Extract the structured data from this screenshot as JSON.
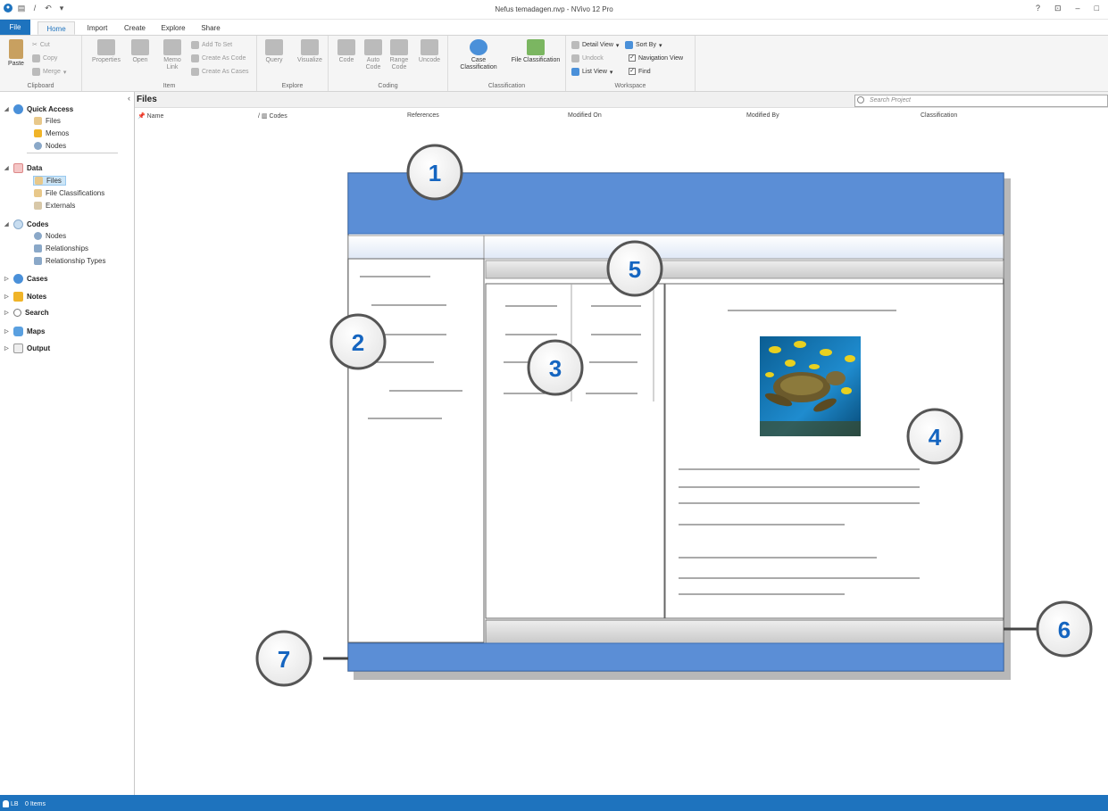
{
  "window": {
    "title": "Nefus temadagen.nvp - NVivo 12 Pro",
    "help": "?",
    "restore": "⊡",
    "minimize": "–",
    "maximize": "□"
  },
  "ribbon_tabs": [
    "File",
    "Home",
    "Import",
    "Create",
    "Explore",
    "Share"
  ],
  "ribbon": {
    "clipboard": {
      "paste": "Paste",
      "cut": "Cut",
      "copy": "Copy",
      "merge": "Merge",
      "label": "Clipboard"
    },
    "item": {
      "properties": "Properties",
      "open": "Open",
      "memo_link": "Memo Link",
      "add_to_set": "Add To Set",
      "create_as_code": "Create As Code",
      "create_as_cases": "Create As Cases",
      "label": "Item"
    },
    "explore": {
      "query": "Query",
      "visualize": "Visualize",
      "label": "Explore"
    },
    "coding": {
      "code": "Code",
      "auto_code": "Auto Code",
      "range_code": "Range Code",
      "uncode": "Uncode",
      "label": "Coding"
    },
    "classification": {
      "case": "Case Classification",
      "file": "File Classification",
      "label": "Classification"
    },
    "workspace": {
      "detail_view": "Detail View",
      "sort_by": "Sort By",
      "undock": "Undock",
      "navigation_view": "Navigation View",
      "list_view": "List View",
      "find": "Find",
      "label": "Workspace"
    }
  },
  "nav": {
    "quick_access": {
      "label": "Quick Access",
      "items": [
        "Files",
        "Memos",
        "Nodes"
      ]
    },
    "data": {
      "label": "Data",
      "items": [
        "Files",
        "File Classifications",
        "Externals"
      ]
    },
    "codes": {
      "label": "Codes",
      "items": [
        "Nodes",
        "Relationships",
        "Relationship Types"
      ]
    },
    "cases": "Cases",
    "notes": "Notes",
    "search": "Search",
    "maps": "Maps",
    "output": "Output"
  },
  "files_panel": {
    "title": "Files",
    "search_placeholder": "Search Project",
    "columns": [
      "Name",
      "Codes",
      "References",
      "Modified On",
      "Modified By",
      "Classification"
    ]
  },
  "diagram_callouts": [
    "1",
    "2",
    "3",
    "4",
    "5",
    "6",
    "7"
  ],
  "status": {
    "user": "LB",
    "items": "0 Items"
  },
  "colors": {
    "accent": "#1e73be",
    "diagram_blue": "#5b8ed6",
    "callout_number": "#1565c0"
  }
}
